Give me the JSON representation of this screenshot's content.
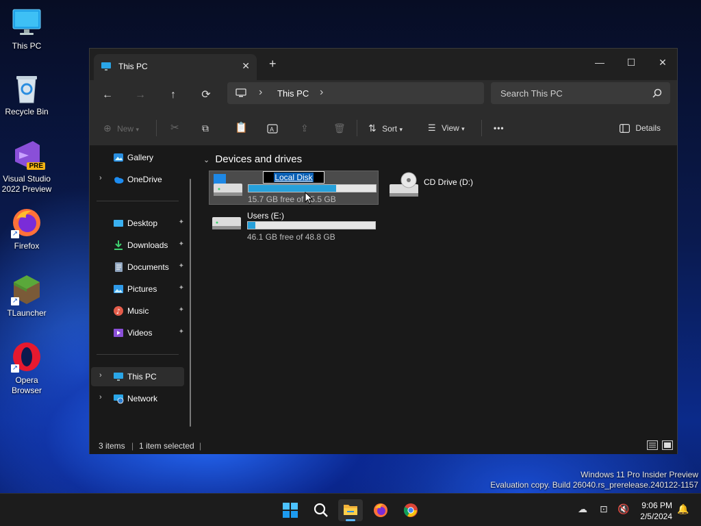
{
  "desktop": {
    "icons": [
      {
        "label": "This PC",
        "icon": "monitor-icon"
      },
      {
        "label": "Recycle Bin",
        "icon": "recycle-bin-icon"
      },
      {
        "label": "Visual Studio 2022 Preview",
        "icon": "visual-studio-icon",
        "badge": "PRE"
      },
      {
        "label": "Firefox",
        "icon": "firefox-icon"
      },
      {
        "label": "TLauncher",
        "icon": "minecraft-block-icon"
      },
      {
        "label": "Opera Browser",
        "icon": "opera-icon"
      }
    ]
  },
  "explorer": {
    "tab": {
      "title": "This PC",
      "close_glyph": "✕"
    },
    "new_tab_glyph": "+",
    "window_controls": {
      "minimize": "—",
      "maximize": "☐",
      "close": "✕"
    },
    "nav": {
      "back": "←",
      "forward": "→",
      "up": "↑",
      "refresh": "⟳"
    },
    "address": {
      "crumb": "This PC",
      "sep": "›"
    },
    "search": {
      "placeholder": "Search This PC"
    },
    "toolbar": {
      "new_label": "New",
      "sort_label": "Sort",
      "view_label": "View",
      "more_label": "•••",
      "details_label": "Details"
    },
    "sidebar": {
      "items": [
        {
          "label": "Gallery",
          "icon": "gallery-icon",
          "expandable": false,
          "pinned": false
        },
        {
          "label": "OneDrive",
          "icon": "onedrive-cloud-icon",
          "expandable": true,
          "pinned": false
        },
        {
          "label": "Desktop",
          "icon": "desktop-folder-icon",
          "expandable": false,
          "pinned": true
        },
        {
          "label": "Downloads",
          "icon": "downloads-icon",
          "expandable": false,
          "pinned": true
        },
        {
          "label": "Documents",
          "icon": "documents-icon",
          "expandable": false,
          "pinned": true
        },
        {
          "label": "Pictures",
          "icon": "pictures-icon",
          "expandable": false,
          "pinned": true
        },
        {
          "label": "Music",
          "icon": "music-icon",
          "expandable": false,
          "pinned": true
        },
        {
          "label": "Videos",
          "icon": "videos-icon",
          "expandable": false,
          "pinned": true
        },
        {
          "label": "This PC",
          "icon": "this-pc-icon",
          "expandable": true,
          "pinned": false,
          "selected": true
        },
        {
          "label": "Network",
          "icon": "network-icon",
          "expandable": true,
          "pinned": false
        }
      ],
      "pin_glyph": "📌",
      "chevron_glyph": "›"
    },
    "content": {
      "group_title": "Devices and drives",
      "group_chevron": "⌄",
      "drives": [
        {
          "name": "Local Disk",
          "renaming": true,
          "free_text": "15.7 GB free of ?5.5 GB",
          "used_fraction": 0.69,
          "selected": true
        },
        {
          "name": "CD Drive (D:)",
          "type": "cd",
          "selected": false
        },
        {
          "name": "Users (E:)",
          "free_text": "46.1 GB free of 48.8 GB",
          "used_fraction": 0.06,
          "selected": false
        }
      ]
    },
    "status": {
      "items": "3 items",
      "selected": "1 item selected",
      "sep": "|"
    }
  },
  "watermark": {
    "line1": "Windows 11 Pro Insider Preview",
    "line2": "Evaluation copy. Build 26040.rs_prerelease.240122-1157"
  },
  "taskbar": {
    "apps": [
      "windows-start-icon",
      "search-icon",
      "file-explorer-icon",
      "firefox-icon",
      "chrome-icon"
    ],
    "clock": {
      "time": "9:06 PM",
      "date": "2/5/2024"
    }
  },
  "colors": {
    "accent": "#26a0da",
    "selection": "#0a5fb4",
    "window_bg": "#191919",
    "toolbar_bg": "#2c2c2c"
  }
}
